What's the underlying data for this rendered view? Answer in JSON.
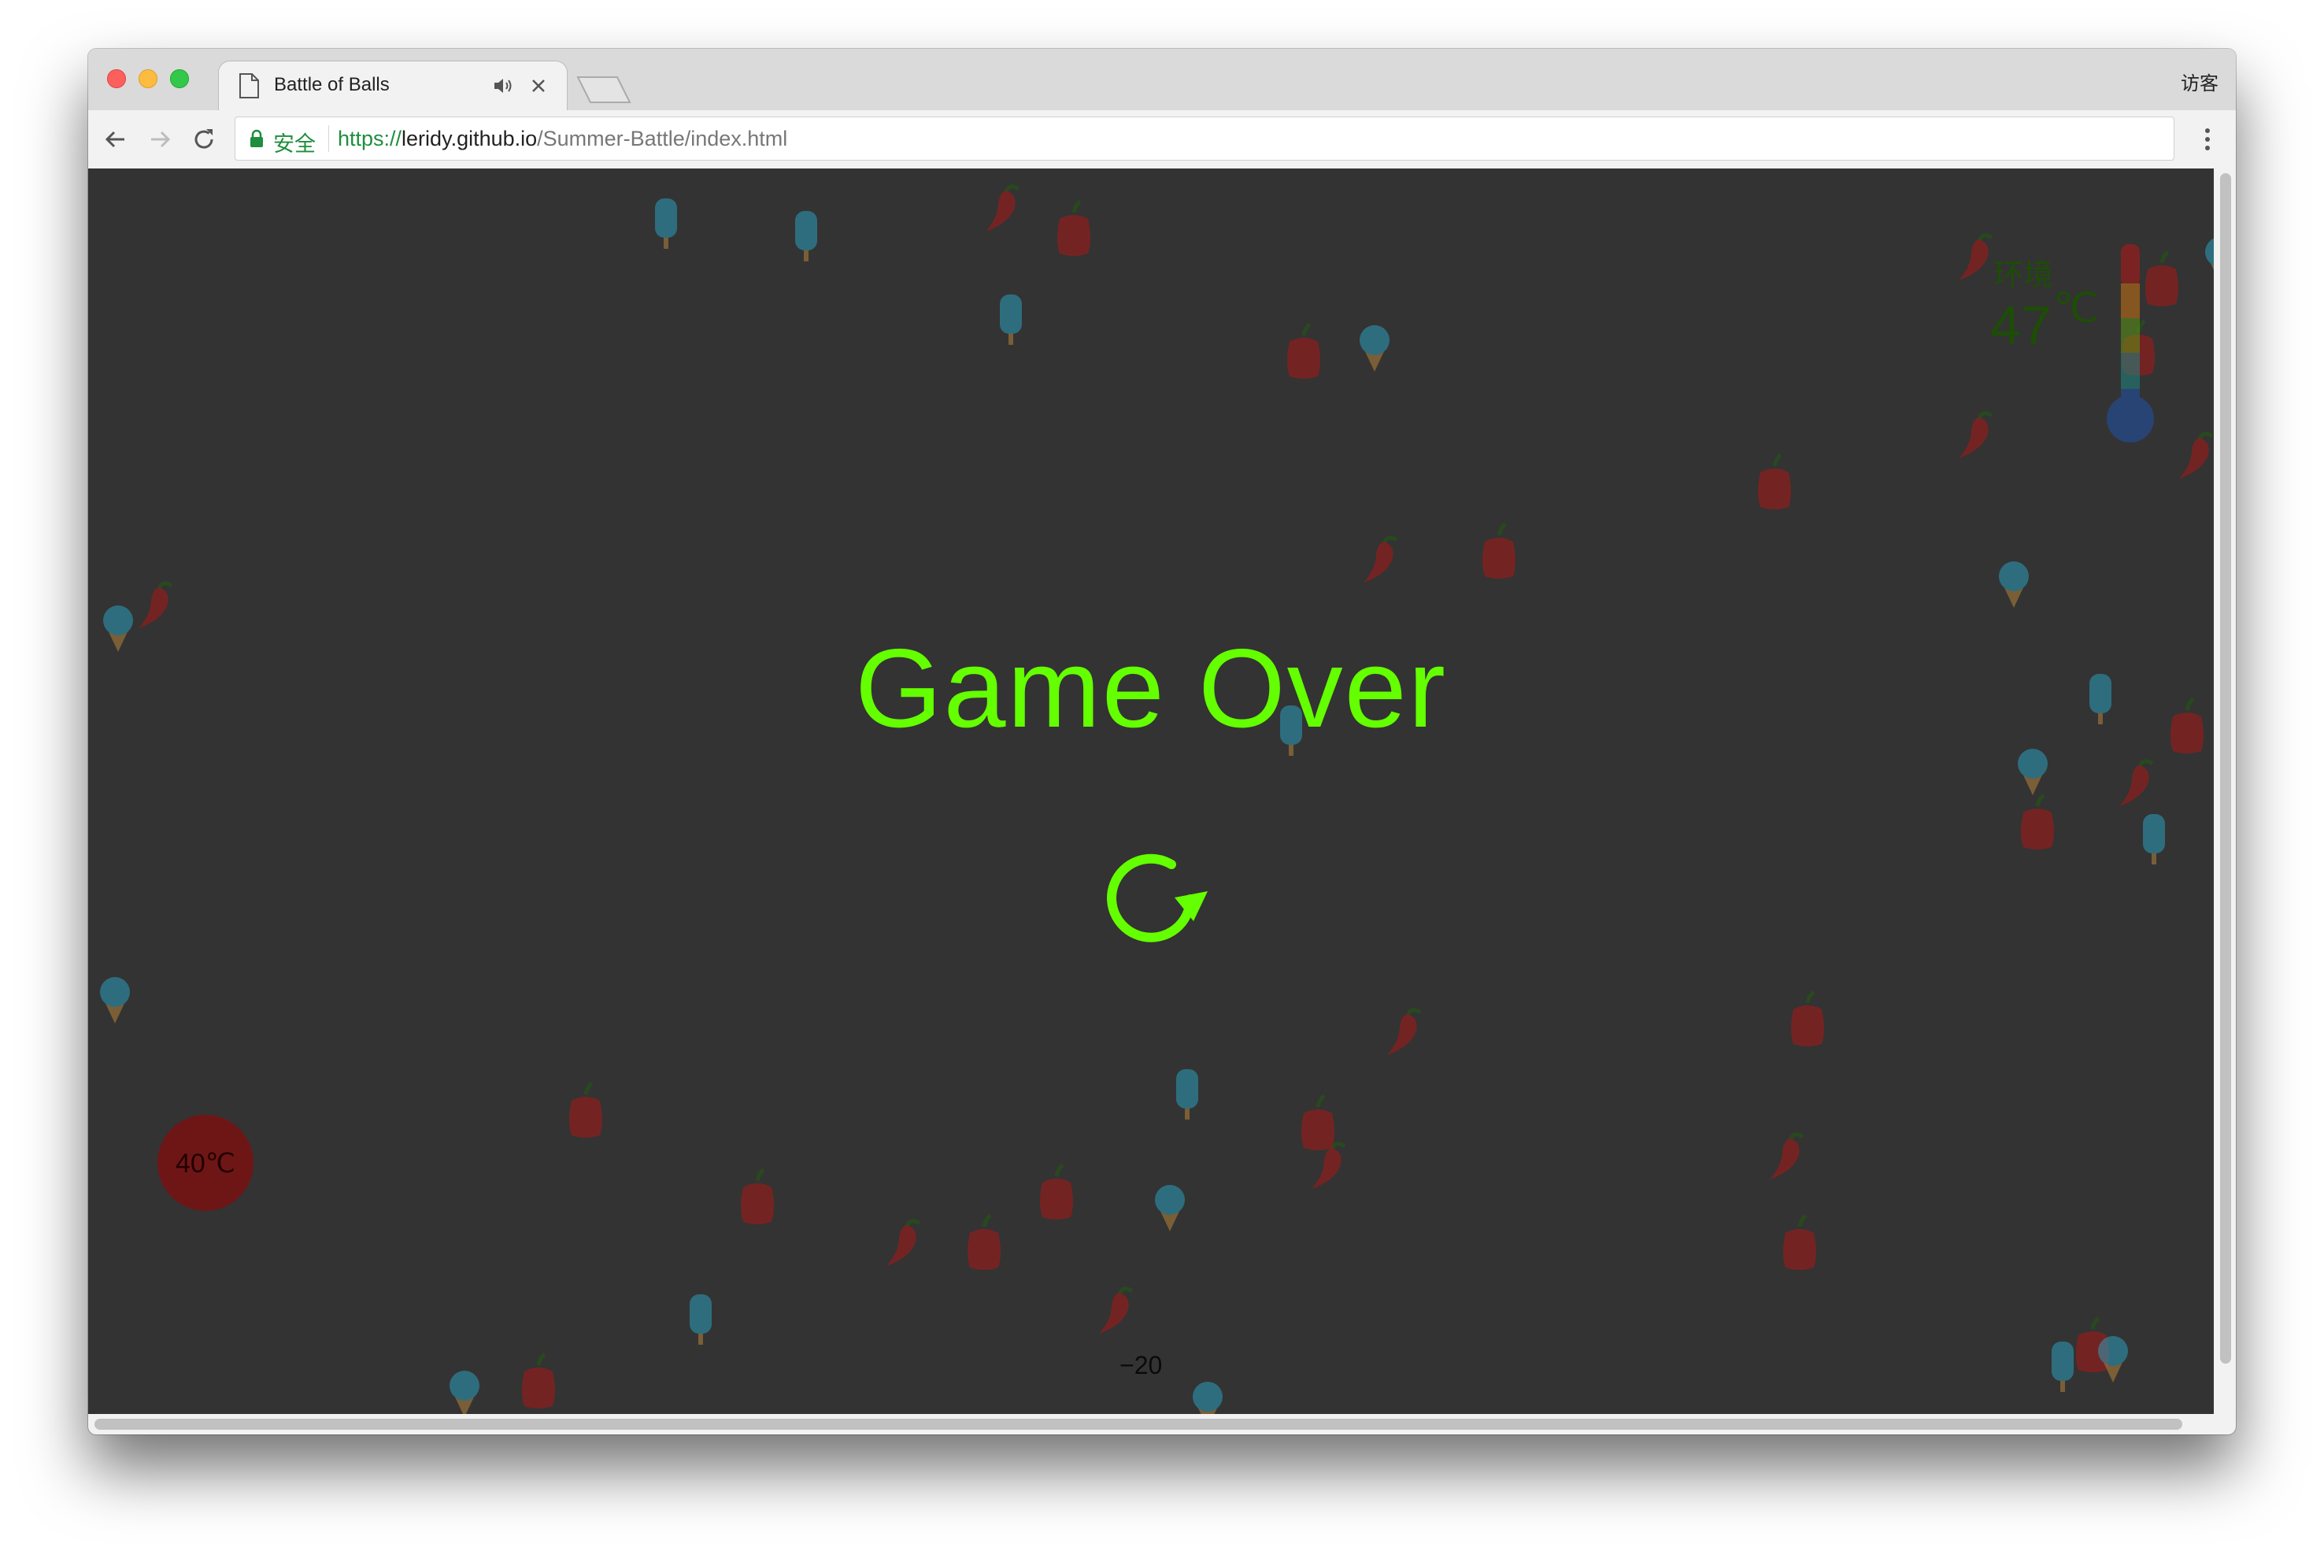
{
  "tab": {
    "title": "Battle of Balls",
    "icons": [
      "page-icon",
      "audio-icon",
      "close-icon"
    ]
  },
  "profile": {
    "label": "访客"
  },
  "omnibox": {
    "secure_label": "安全",
    "url_scheme": "https://",
    "url_host": "leridy.github.io",
    "url_path": "/Summer-Battle/index.html"
  },
  "game": {
    "game_over": "Game Over",
    "restart_icon": "refresh-icon",
    "player_temp": "40℃",
    "env_label": "环境",
    "env_temp_value": "47",
    "env_temp_unit": "℃",
    "score_change": "−20",
    "accent_color": "#64ff00"
  }
}
